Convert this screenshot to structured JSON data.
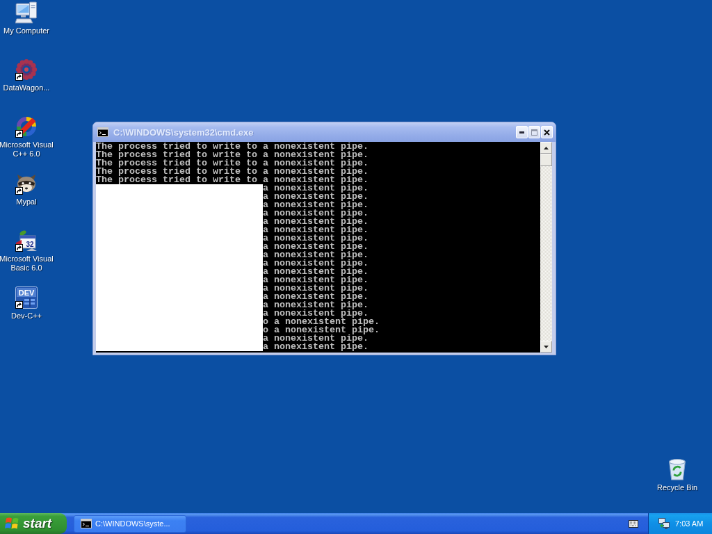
{
  "desktop_icons": [
    {
      "label": "My Computer",
      "kind": "computer",
      "shortcut": false
    },
    {
      "label": "DataWagon...",
      "kind": "dot-ring",
      "shortcut": true
    },
    {
      "label": "Microsoft Visual C++ 6.0",
      "kind": "color-ring",
      "shortcut": true
    },
    {
      "label": "Mypal",
      "kind": "raccoon",
      "shortcut": true
    },
    {
      "label": "Microsoft Visual Basic 6.0",
      "kind": "program-window",
      "shortcut": true,
      "icon_text": "32"
    },
    {
      "label": "Dev-C++",
      "kind": "dev-tile",
      "shortcut": true,
      "icon_text": "DEV"
    }
  ],
  "recycle_bin": {
    "label": "Recycle Bin"
  },
  "window": {
    "title": "C:\\WINDOWS\\system32\\cmd.exe",
    "active": false,
    "console": {
      "lines": [
        "The process tried to write to a nonexistent pipe.",
        "The process tried to write to a nonexistent pipe.",
        "The process tried to write to a nonexistent pipe.",
        "The process tried to write to a nonexistent pipe.",
        "The process tried to write to a nonexistent pipe."
      ],
      "covered_lines": [
        "a nonexistent pipe.",
        "a nonexistent pipe.",
        "a nonexistent pipe.",
        "a nonexistent pipe.",
        "a nonexistent pipe.",
        "a nonexistent pipe.",
        "a nonexistent pipe.",
        "a nonexistent pipe.",
        "a nonexistent pipe.",
        "a nonexistent pipe.",
        "a nonexistent pipe.",
        "a nonexistent pipe.",
        "a nonexistent pipe.",
        "a nonexistent pipe.",
        "a nonexistent pipe.",
        "a nonexistent pipe.",
        "o a nonexistent pipe.",
        "o a nonexistent pipe.",
        "a nonexistent pipe.",
        "a nonexistent pipe."
      ]
    }
  },
  "taskbar": {
    "start_label": "start",
    "tasks": [
      {
        "label": "C:\\WINDOWS\\syste...",
        "selected": false
      }
    ],
    "clock": "7:03 AM"
  }
}
